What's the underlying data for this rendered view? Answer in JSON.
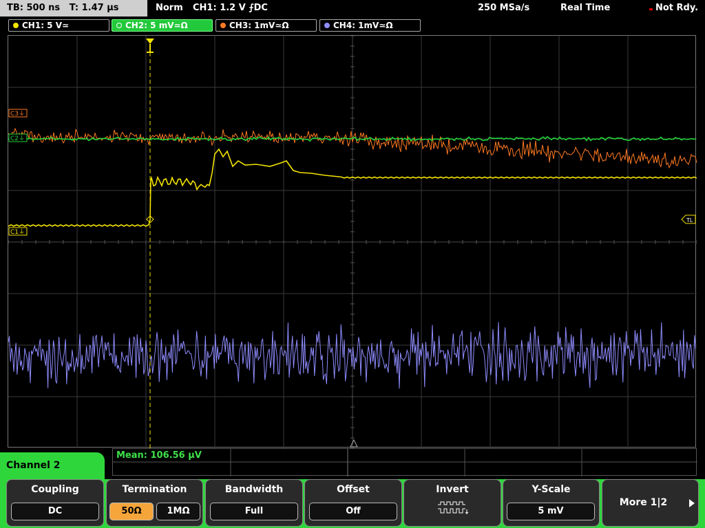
{
  "topbar": {
    "timebase": "TB: 500 ns",
    "trigger_time": "T: 1.47 µs",
    "trigger_mode": "Norm",
    "trigger_setting": "CH1: 1.2 V ⨍DC",
    "sample_rate": "250 MSa/s",
    "acq_mode": "Real Time",
    "status": "Not Rdy."
  },
  "channels": [
    {
      "label": "CH1: 5 V≃",
      "color": "#f4e400"
    },
    {
      "label": "CH2: 5 mV≃Ω",
      "color": "#22c93a"
    },
    {
      "label": "CH3: 1mV≃Ω",
      "color": "#ff7a22"
    },
    {
      "label": "CH4: 1mV≃Ω",
      "color": "#8f8cff"
    }
  ],
  "markers": {
    "c3": "C3⏚",
    "c2": "C2⏚",
    "c1": "C1⏚",
    "trigger_level": "TL"
  },
  "measurement": {
    "mean": "Mean: 106.56 µV"
  },
  "menu": {
    "title": "Channel 2",
    "softkeys": {
      "coupling": {
        "title": "Coupling",
        "value": "DC"
      },
      "termination": {
        "title": "Termination",
        "opt1": "50Ω",
        "opt2": "1MΩ",
        "active": "50Ω"
      },
      "bandwidth": {
        "title": "Bandwidth",
        "value": "Full"
      },
      "offset": {
        "title": "Offset",
        "value": "Off"
      },
      "invert": {
        "title": "Invert",
        "icon": "invert-waveform-icon"
      },
      "yscale": {
        "title": "Y-Scale",
        "value": "5 mV"
      },
      "more": {
        "label": "More 1|2"
      }
    }
  }
}
